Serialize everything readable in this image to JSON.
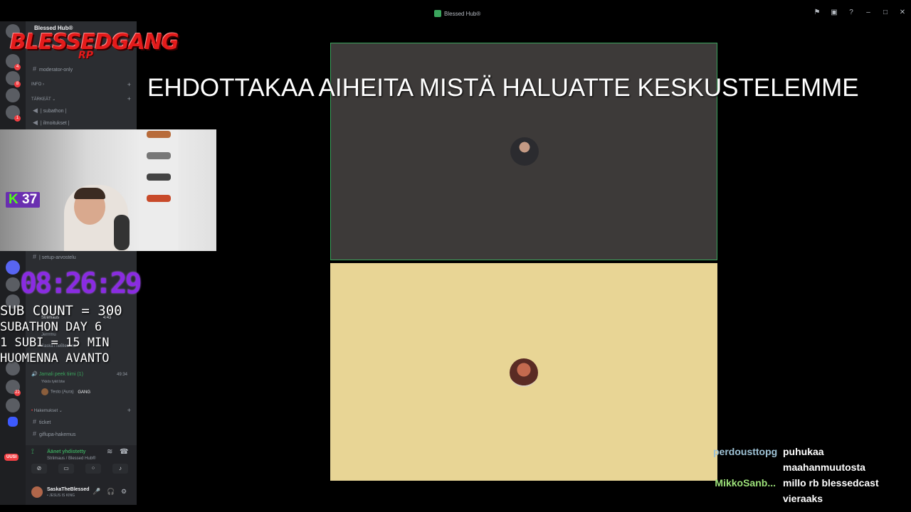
{
  "window": {
    "title": "Blessed Hub®",
    "controls": [
      "flag-icon",
      "screen-icon",
      "help-icon",
      "minimize-icon",
      "maximize-icon",
      "close-icon"
    ]
  },
  "server": {
    "name": "Blessed Hub®"
  },
  "sidebar": {
    "channels": [
      {
        "name": "moderator-only"
      },
      {
        "name": "| subathon |"
      },
      {
        "name": "| ilmoitukset |"
      },
      {
        "name": "| setup-arvostelu"
      },
      {
        "name": "ticket"
      },
      {
        "name": "giflupa-hakemus"
      }
    ],
    "categories": [
      "INFO",
      "TÄRKEÄT",
      "Hakemukset"
    ],
    "voice_channel": {
      "name": "Jamali peek tiimi (1)",
      "time": "49:34",
      "status_text": "Ykkös tykit btw",
      "member": "Testo (Aura)",
      "member_tag": "GANG"
    },
    "other_voice": {
      "name": "Striimaus",
      "time": "4:43",
      "users": [
        "Jerrrmu",
        "SaskaTheBlessed"
      ]
    }
  },
  "voice_panel": {
    "status": "Äänet yhdistetty",
    "location": "Striimaus / Blessed Hub®"
  },
  "user_panel": {
    "name": "SaskaTheBlessed",
    "status": "• JESUS IS KING"
  },
  "rail": {
    "new_label": "UUSI"
  },
  "overlay": {
    "logo_text": "BLESSEDGANG",
    "logo_sub": "RP",
    "kick_viewers": "37",
    "timer": "08:26:29",
    "sub_count": "SUB COUNT = 300",
    "subathon_day": "SUBATHON DAY 6",
    "sub_rate": "1 SUBI = 15 MIN",
    "tomorrow": "HUOMENNA AVANTO",
    "headline": "EHDOTTAKAA AIHEITA MISTÄ HALUATTE KESKUSTELEMME"
  },
  "chat": [
    {
      "user": "perdousttopg",
      "color": "#9fc3d6",
      "lines": [
        "puhukaa",
        "maahanmuutosta"
      ]
    },
    {
      "user": "MikkoSanb...",
      "color": "#9de27a",
      "lines": [
        "millo rb blessedcast",
        "vieraaks"
      ]
    }
  ]
}
